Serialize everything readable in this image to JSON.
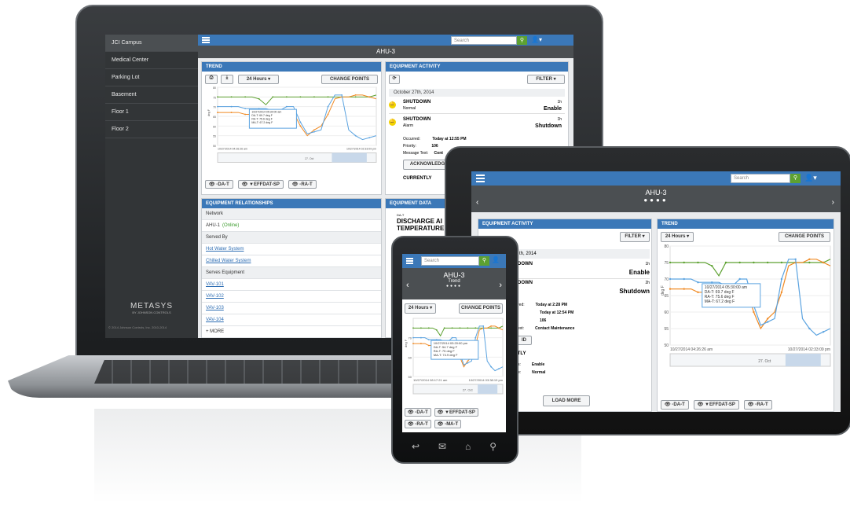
{
  "laptop": {
    "sidebar": {
      "items": [
        "JCI Campus",
        "Medical Center",
        "Parking Lot",
        "Basement",
        "Floor 1",
        "Floor 2"
      ],
      "logo": "METASYS",
      "logo_sub": "BY JOHNSON CONTROLS",
      "copyright": "© 2014 Johnson Controls, Inc. 2010-2014"
    },
    "search_placeholder": "Search",
    "title": "AHU-3",
    "trend": {
      "header": "TREND",
      "range": "24 Hours",
      "change_points": "CHANGE POINTS",
      "tooltip": [
        "10/27/2014 05:30:00 am",
        "DA-T: 69.7 deg F",
        "RA-T: 75.6 deg F",
        "MA-T: 67.2 deg F"
      ],
      "ylabel": "deg F",
      "yticks": [
        "80",
        "75",
        "70",
        "65",
        "60",
        "55",
        "50"
      ],
      "start_label": "10/27/2014 04:26:26 am",
      "end_label": "10/27/2014 02:33:09 pm",
      "nav_label": "27. Oct",
      "legend": [
        "DA-T",
        "EFFDAT-SP",
        "RA-T"
      ]
    },
    "activity": {
      "header": "EQUIPMENT ACTIVITY",
      "filter": "FILTER",
      "date": "October 27th, 2014",
      "events": [
        {
          "title": "SHUTDOWN",
          "sub": "Normal",
          "time": "1h",
          "value": "Enable"
        },
        {
          "title": "SHUTDOWN",
          "sub": "Alarm",
          "time": "1h",
          "value": "Shutdown"
        }
      ],
      "details": [
        {
          "k": "Occurred:",
          "v": "Today at 12:55 PM"
        },
        {
          "k": "Priority:",
          "v": "106"
        },
        {
          "k": "Message Text:",
          "v": "Cont"
        }
      ],
      "acknowledge": "ACKNOWLEDGE",
      "currently": "CURRENTLY"
    },
    "relationships": {
      "header": "EQUIPMENT RELATIONSHIPS",
      "rows": [
        {
          "text": "Network",
          "type": "gray"
        },
        {
          "text": "AHU-1",
          "type": "plain",
          "suffix": "(Online)"
        },
        {
          "text": "Served By",
          "type": "gray"
        },
        {
          "text": "Hot Water System",
          "type": "link"
        },
        {
          "text": "Chilled Water System",
          "type": "link"
        },
        {
          "text": "Serves Equipment",
          "type": "gray"
        },
        {
          "text": "VAV-101",
          "type": "link"
        },
        {
          "text": "VAV-102",
          "type": "link"
        },
        {
          "text": "VAV-103",
          "type": "link"
        },
        {
          "text": "VAV-104",
          "type": "link"
        }
      ],
      "more": "+ MORE"
    },
    "equipment_data": {
      "header": "EQUIPMENT DATA",
      "item_small": "DA-T",
      "item_line1": "DISCHARGE AI",
      "item_line2": "TEMPERATURE"
    }
  },
  "tablet": {
    "search_placeholder": "Search",
    "title": "AHU-3",
    "activity": {
      "header": "EQUIPMENT ACTIVITY",
      "filter": "FILTER",
      "date": "th, 2014",
      "events": [
        {
          "title": "DOWN",
          "time": "1h",
          "value": "Enable"
        },
        {
          "title": "DOWN",
          "time": "2h",
          "value": "Shutdown"
        }
      ],
      "details": [
        {
          "k": "red:",
          "v": "Today at 2:28 PM"
        },
        {
          "k": "",
          "v": "Today at 12:54 PM"
        },
        {
          "k": "",
          "v": "106"
        },
        {
          "k": "ext:",
          "v": "Contact Maintenance"
        }
      ],
      "ack": "ID",
      "currently": "ITLY",
      "current_rows": [
        {
          "k": "s:",
          "v": "Enable"
        },
        {
          "k": "e:",
          "v": "Normal"
        }
      ],
      "load_more": "LOAD MORE"
    },
    "trend": {
      "header": "TREND",
      "range": "24 Hours",
      "change_points": "CHANGE POINTS",
      "tooltip": [
        "10/27/2014 05:30:00 am",
        "DA-T: 69.7 deg F",
        "RA-T: 75.6 deg F",
        "MA-T: 67.2 deg F"
      ],
      "ylabel": "deg F",
      "yticks": [
        "80",
        "75",
        "70",
        "65",
        "60",
        "55",
        "50"
      ],
      "start_label": "10/27/2014 04:26:26 am",
      "end_label": "10/27/2014 02:33:09 pm",
      "nav_label": "27. Oct",
      "legend": [
        "DA-T",
        "EFFDAT-SP",
        "RA-T"
      ]
    }
  },
  "phone": {
    "search_placeholder": "Search",
    "title": "AHU-3",
    "subtitle": "Trend",
    "range": "24 Hours",
    "change_points": "CHANGE POINTS",
    "tooltip": [
      "10/27/2014 03:20:00 pm",
      "DA-T: 54.7 deg F",
      "RA-T: 75 deg F",
      "MA-T: 74.9 deg F"
    ],
    "ylabel": "deg F",
    "yticks": [
      "70",
      "60",
      "50"
    ],
    "start_label": "10/27/2014 08:17:21 am",
    "end_label": "10/27/2014 03:38:19 pm",
    "nav_label": "27. Oct",
    "legend": [
      "DA-T",
      "EFFDAT-SP",
      "RA-T",
      "MA-T"
    ]
  },
  "colors": {
    "blue": "#3b78b8",
    "green": "#5da131",
    "orange": "#f08a24",
    "lightblue": "#5ba3e0",
    "dark": "#323537"
  },
  "chart_data": [
    {
      "type": "line",
      "title": "",
      "xlabel": "",
      "ylabel": "deg F",
      "ylim": [
        50,
        80
      ],
      "legend": "bottom",
      "series": [
        {
          "name": "RA-T",
          "color": "#5da131",
          "values": [
            75,
            75,
            75,
            75,
            75,
            75,
            74,
            71,
            75,
            75,
            75,
            75,
            75,
            75,
            75,
            75,
            75,
            75,
            75,
            75,
            75,
            75,
            75,
            76
          ]
        },
        {
          "name": "MA-T",
          "color": "#f08a24",
          "values": [
            67,
            67,
            67,
            67,
            66,
            66,
            66,
            66,
            65,
            66,
            67,
            67,
            60,
            55,
            58,
            60,
            66,
            74,
            75,
            75,
            76,
            76,
            75,
            74
          ]
        },
        {
          "name": "DA-T",
          "color": "#5ba3e0",
          "values": [
            70,
            70,
            70,
            70,
            69,
            69,
            69,
            69,
            68,
            68,
            70,
            70,
            62,
            56,
            57,
            58,
            70,
            76,
            76,
            58,
            55,
            53,
            54,
            55
          ]
        }
      ]
    }
  ]
}
